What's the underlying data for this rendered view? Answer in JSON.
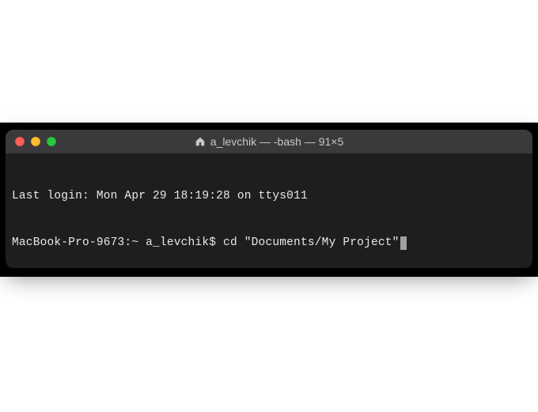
{
  "window": {
    "title": "a_levchik — -bash — 91×5",
    "icon": "home-icon",
    "colors": {
      "close": "#ff5f57",
      "minimize": "#febc2e",
      "maximize": "#28c840",
      "titlebar_bg": "#3a3a3c",
      "body_bg": "#1e1e1e",
      "text": "#e8e8e8",
      "cursor": "#9fa0a1"
    }
  },
  "terminal": {
    "last_login_line": "Last login: Mon Apr 29 18:19:28 on ttys011",
    "prompt": "MacBook-Pro-9673:~ a_levchik$ ",
    "command": "cd \"Documents/My Project\""
  }
}
